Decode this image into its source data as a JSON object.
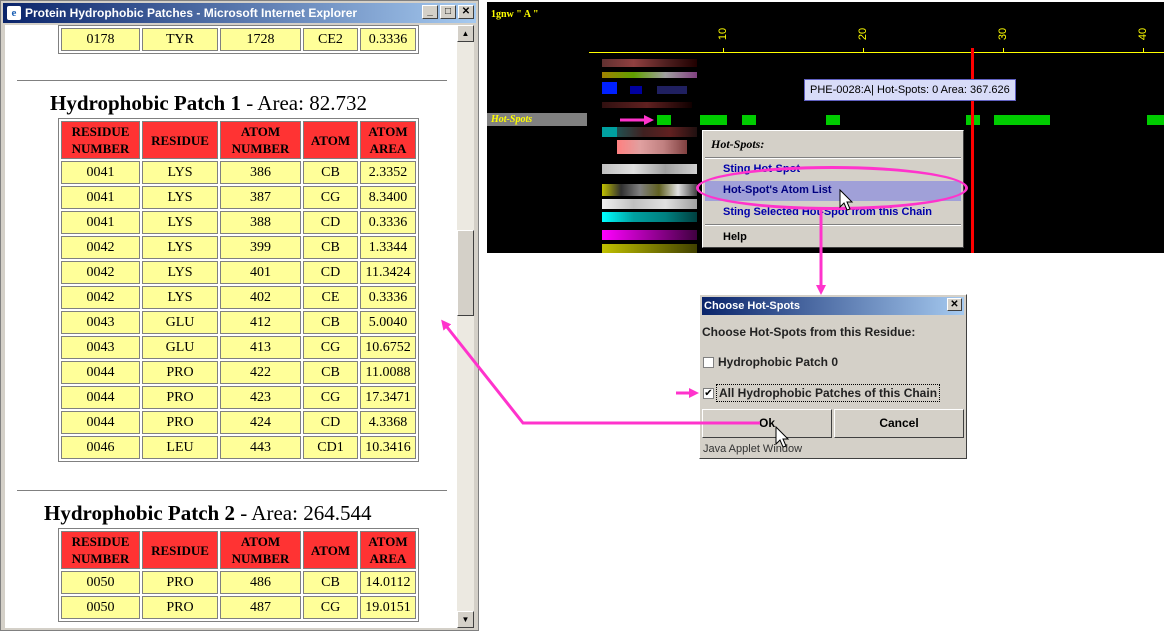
{
  "browser": {
    "title": "Protein Hydrophobic Patches - Microsoft Internet Explorer",
    "icon": "ie-icon",
    "buttons": {
      "minimize": "_",
      "maximize": "□",
      "close": "✕"
    }
  },
  "top_row": {
    "cells": [
      "0178",
      "TYR",
      "1728",
      "CE2",
      "0.3336"
    ]
  },
  "patches": [
    {
      "title_bold": "Hydrophobic Patch 1",
      "title_rest": " - Area: 82.732",
      "headers": [
        "RESIDUE NUMBER",
        "RESIDUE",
        "ATOM NUMBER",
        "ATOM",
        "ATOM AREA"
      ],
      "rows": [
        [
          "0041",
          "LYS",
          "386",
          "CB",
          "2.3352"
        ],
        [
          "0041",
          "LYS",
          "387",
          "CG",
          "8.3400"
        ],
        [
          "0041",
          "LYS",
          "388",
          "CD",
          "0.3336"
        ],
        [
          "0042",
          "LYS",
          "399",
          "CB",
          "1.3344"
        ],
        [
          "0042",
          "LYS",
          "401",
          "CD",
          "11.3424"
        ],
        [
          "0042",
          "LYS",
          "402",
          "CE",
          "0.3336"
        ],
        [
          "0043",
          "GLU",
          "412",
          "CB",
          "5.0040"
        ],
        [
          "0043",
          "GLU",
          "413",
          "CG",
          "10.6752"
        ],
        [
          "0044",
          "PRO",
          "422",
          "CB",
          "11.0088"
        ],
        [
          "0044",
          "PRO",
          "423",
          "CG",
          "17.3471"
        ],
        [
          "0044",
          "PRO",
          "424",
          "CD",
          "4.3368"
        ],
        [
          "0046",
          "LEU",
          "443",
          "CD1",
          "10.3416"
        ]
      ]
    },
    {
      "title_bold": "Hydrophobic Patch 2",
      "title_rest": " - Area: 264.544",
      "headers": [
        "RESIDUE NUMBER",
        "RESIDUE",
        "ATOM NUMBER",
        "ATOM",
        "ATOM AREA"
      ],
      "rows": [
        [
          "0050",
          "PRO",
          "486",
          "CB",
          "14.0112"
        ],
        [
          "0050",
          "PRO",
          "487",
          "CG",
          "19.0151"
        ]
      ]
    }
  ],
  "applet": {
    "chain_label": "1gnw \" A \"",
    "ruler_ticks": [
      "10",
      "20",
      "30",
      "40"
    ],
    "track_label": "Hot-Spots",
    "tooltip": "PHE-0028:A| Hot-Spots: 0  Area: 367.626",
    "context_menu": {
      "title": "Hot-Spots:",
      "items": [
        "Sting Hot-Spot",
        "Hot-Spot's Atom List",
        "Sting Selected Hot-Spot from this Chain",
        "Help"
      ],
      "highlighted_index": 1
    },
    "colors": {
      "background": "#000000",
      "ruler": "#ffff00",
      "hotspot": "#00cc00",
      "marker": "#ff0000"
    }
  },
  "dialog": {
    "title": "Choose Hot-Spots",
    "prompt": "Choose Hot-Spots from this Residue:",
    "options": [
      {
        "label": "Hydrophobic Patch 0",
        "checked": false
      },
      {
        "label": "All Hydrophobic Patches of this Chain",
        "checked": true
      }
    ],
    "ok_label": "Ok",
    "cancel_label": "Cancel",
    "footer": "Java Applet Window"
  },
  "annotation_color": "#ff33cc"
}
